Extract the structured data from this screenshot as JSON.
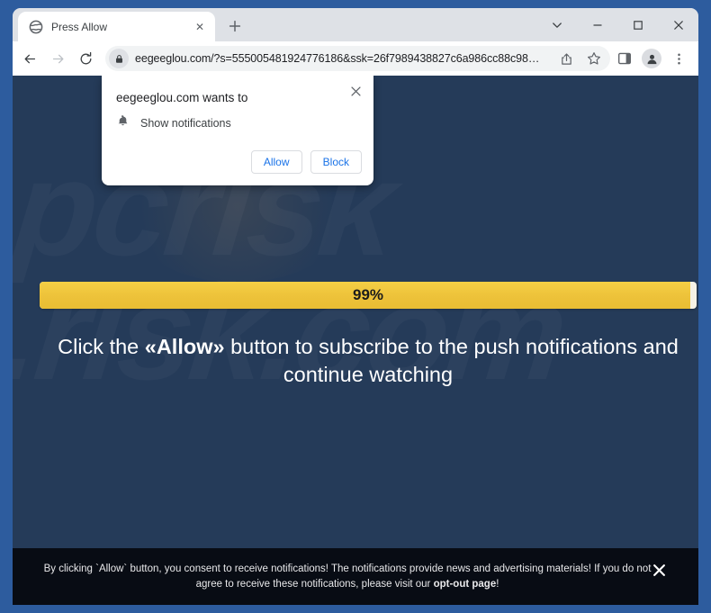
{
  "browser": {
    "tab": {
      "title": "Press Allow",
      "favicon_name": "globe-icon",
      "close_glyph": "✕"
    },
    "newtab_glyph": "+",
    "window_controls": {
      "tab_search_glyph": "⌄",
      "minimize_glyph": "—",
      "maximize_glyph": "□",
      "close_glyph": "✕"
    },
    "toolbar": {
      "back_glyph": "←",
      "forward_glyph": "→",
      "reload_glyph": "↻",
      "url": "eegeeglou.com/?s=555005481924776186&ssk=26f7989438827c6a986cc88c98…",
      "lock_name": "lock-icon",
      "share_name": "share-icon",
      "bookmark_glyph": "☆",
      "side_panel_name": "side-panel-icon",
      "profile_name": "profile-avatar",
      "menu_glyph": "⋮"
    }
  },
  "permission_dialog": {
    "title": "eegeeglou.com wants to",
    "permission_label": "Show notifications",
    "permission_icon": "bell-icon",
    "allow_label": "Allow",
    "block_label": "Block",
    "close_glyph": "✕"
  },
  "page": {
    "watermark_line1": "pcrisk",
    "watermark_line2": ".risk.com",
    "progress": {
      "percent_label": "99%",
      "percent_value": 99
    },
    "headline": {
      "before": "Click the ",
      "emphasis": "«Allow»",
      "after": " button to subscribe to the push notifications and continue watching"
    },
    "consent": {
      "before": "By clicking `Allow` button, you consent to receive notifications! The notifications provide news and advertising materials! If you do not agree to receive these notifications, please visit our ",
      "link": "opt-out page",
      "after": "!",
      "close_glyph": "✕"
    }
  },
  "colors": {
    "page_background": "#253b59",
    "consent_background": "#080c14",
    "progress_fill": "#edc23a",
    "progress_track": "#f6f2e6",
    "frame": "#2d5c9e",
    "link_blue": "#1a73e8"
  }
}
